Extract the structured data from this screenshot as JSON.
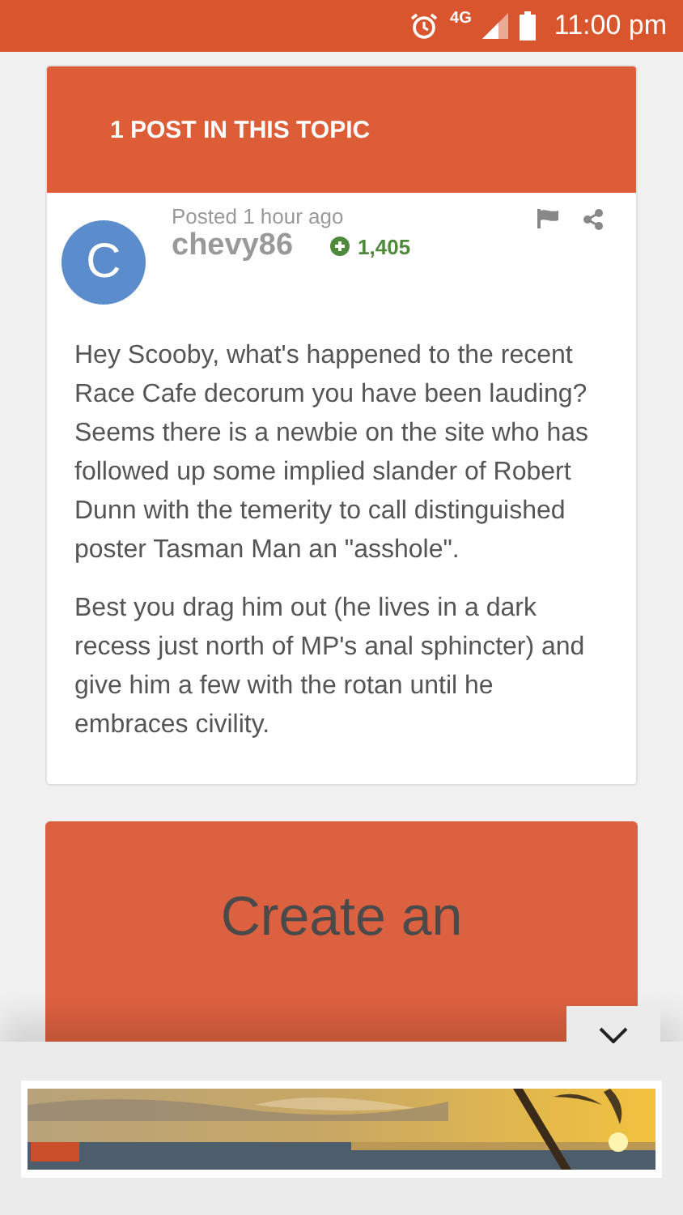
{
  "status_bar": {
    "network": "4G",
    "time": "11:00 pm"
  },
  "topic_header": {
    "title": "1 POST IN THIS TOPIC"
  },
  "post": {
    "avatar_letter": "C",
    "posted": "Posted 1 hour ago",
    "author": "chevy86",
    "reputation": "1,405",
    "paragraphs": [
      "Hey Scooby, what's happened to the recent Race Cafe decorum you have been lauding? Seems there is a newbie on the site who has followed up some implied slander of Robert Dunn with the temerity to call distinguished poster Tasman Man an \"asshole\".",
      "Best you drag him out (he lives in a dark recess just north of MP's anal sphincter) and give him a few with the rotan until he embraces civility."
    ]
  },
  "signup": {
    "title": "Create an"
  },
  "ad_bar": {
    "expanded": false
  }
}
